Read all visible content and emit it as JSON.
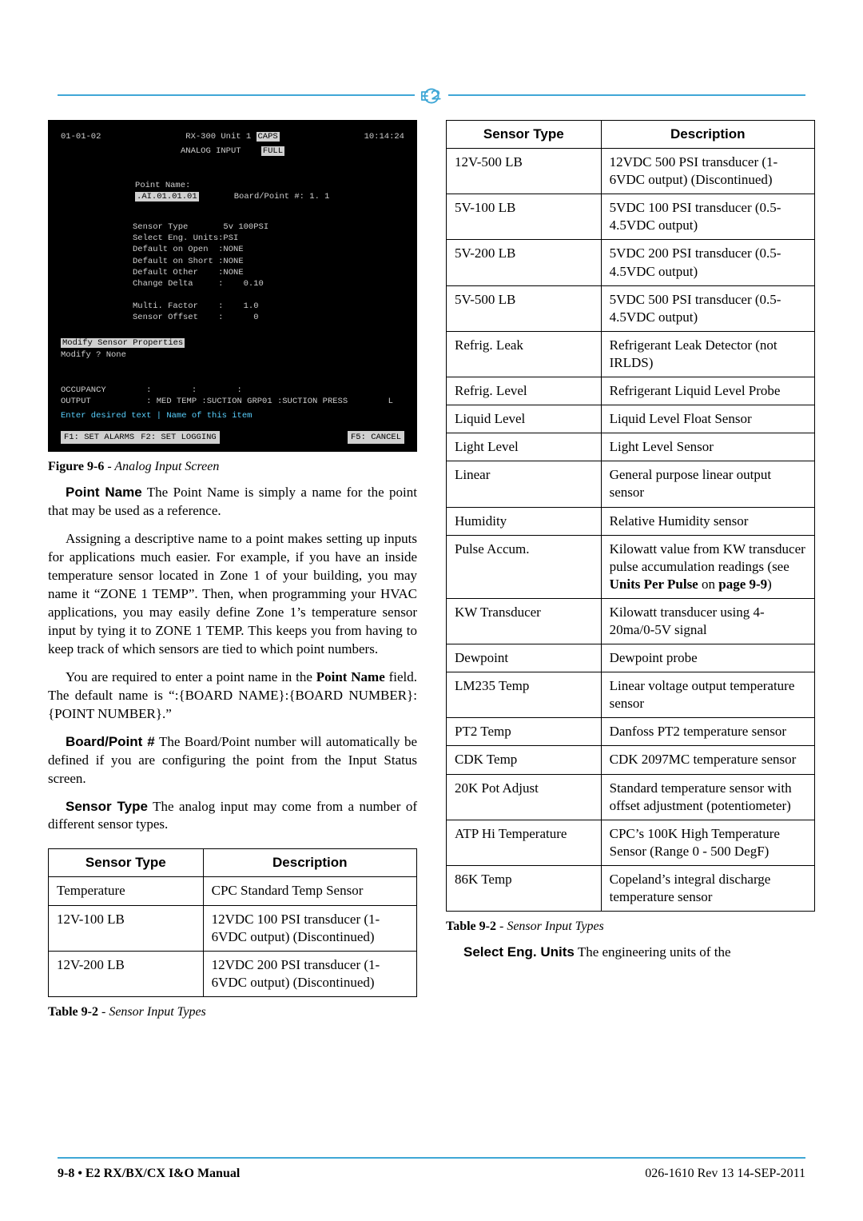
{
  "header": {
    "logo_label": "E2"
  },
  "left": {
    "terminal": {
      "date": "01-01-02",
      "title_line1": "RX-300 Unit 1",
      "caps": "CAPS",
      "title_line2": "ANALOG INPUT",
      "full": "FULL",
      "time": "10:14:24",
      "point_name_label": "Point Name:",
      "point_name_value": ".AI.01.01.01",
      "board_point_label": "Board/Point #:",
      "board_point_value": "1. 1",
      "rows": [
        {
          "k": "Sensor Type",
          "v": "5v 100PSI"
        },
        {
          "k": "Select Eng. Units:",
          "v": "PSI"
        },
        {
          "k": "Default on Open  :",
          "v": "NONE"
        },
        {
          "k": "Default on Short :",
          "v": "NONE"
        },
        {
          "k": "Default Other    :",
          "v": "NONE"
        },
        {
          "k": "Change Delta     :",
          "v": "    0.10"
        }
      ],
      "rows2": [
        {
          "k": "Multi. Factor    :",
          "v": "    1.0"
        },
        {
          "k": "Sensor Offset    :",
          "v": "      0"
        }
      ],
      "modify_line": "Modify Sensor Properties",
      "modify_sub": "Modify         ? None",
      "occ": "OCCUPANCY        :        :        :",
      "output": "OUTPUT           : MED TEMP :SUCTION GRP01 :SUCTION PRESS        L",
      "enter_hint": "Enter desired text  | Name of this item",
      "f1": "F1: SET ALARMS",
      "f2": "F2: SET LOGGING",
      "f5": "F5: CANCEL"
    },
    "fig_caption_bold": "Figure 9-6",
    "fig_caption_text": " - Analog Input Screen",
    "point_name_heading": "Point Name",
    "point_name_para": "   The Point Name is simply a name for the point that may be used as a reference.",
    "para2": "Assigning a descriptive name to a point makes setting up inputs for applications much easier. For example, if you have an inside temperature sensor located in Zone 1 of your building, you may name it “ZONE 1 TEMP”. Then, when programming your HVAC applications, you may easily define Zone 1’s temperature sensor input by tying it to ZONE 1 TEMP. This keeps you from having to keep track of which sensors are tied to which point numbers.",
    "para3_pre": "You are required to enter a point name in the ",
    "para3_bold": "Point Name",
    "para3_post": " field. The default name is “:{BOARD NAME}:{BOARD NUMBER}:{POINT NUMBER}.”",
    "bp_heading": "Board/Point #",
    "bp_para": "   The Board/Point number will automatically be defined if you are configuring the point from the Input Status screen.",
    "st_heading": "Sensor Type",
    "st_para": "   The analog input may come from a number of different sensor types.",
    "table1": {
      "headers": [
        "Sensor Type",
        "Description"
      ],
      "rows": [
        [
          "Temperature",
          "CPC Standard Temp Sensor"
        ],
        [
          "12V-100 LB",
          "12VDC 100 PSI transducer (1-6VDC output) (Discontinued)"
        ],
        [
          "12V-200 LB",
          "12VDC 200 PSI transducer (1-6VDC output) (Discontinued)"
        ]
      ],
      "caption_bold": "Table 9-2",
      "caption_text": " - Sensor Input Types"
    }
  },
  "right": {
    "table2": {
      "headers": [
        "Sensor Type",
        "Description"
      ],
      "rows": [
        [
          "12V-500 LB",
          "12VDC 500 PSI transducer (1-6VDC output) (Discontinued)"
        ],
        [
          "5V-100 LB",
          "5VDC 100 PSI transducer (0.5-4.5VDC output)"
        ],
        [
          "5V-200 LB",
          "5VDC 200 PSI transducer (0.5-4.5VDC output)"
        ],
        [
          "5V-500 LB",
          "5VDC 500 PSI transducer (0.5-4.5VDC output)"
        ],
        [
          "Refrig. Leak",
          "Refrigerant Leak Detector (not IRLDS)"
        ],
        [
          "Refrig. Level",
          "Refrigerant Liquid Level Probe"
        ],
        [
          "Liquid Level",
          "Liquid Level Float Sensor"
        ],
        [
          "Light Level",
          "Light Level Sensor"
        ],
        [
          "Linear",
          "General purpose linear output sensor"
        ],
        [
          "Humidity",
          "Relative Humidity sensor"
        ],
        [
          "Pulse Accum.",
          "Kilowatt value from KW transducer pulse accumulation readings (see <b>Units Per Pulse</b> on <b>page 9-9</b>)"
        ],
        [
          "KW Transducer",
          "Kilowatt transducer using 4-20ma/0-5V signal"
        ],
        [
          "Dewpoint",
          "Dewpoint probe"
        ],
        [
          "LM235 Temp",
          "Linear voltage output temperature sensor"
        ],
        [
          "PT2 Temp",
          "Danfoss PT2 temperature sensor"
        ],
        [
          "CDK Temp",
          "CDK 2097MC temperature sensor"
        ],
        [
          "20K Pot Adjust",
          "Standard temperature sensor with offset adjustment (potentiometer)"
        ],
        [
          "ATP Hi Temperature",
          "CPC’s 100K High Temperature Sensor (Range  0 - 500 DegF)"
        ],
        [
          "86K Temp",
          "Copeland’s integral discharge temperature sensor"
        ]
      ],
      "caption_bold": "Table 9-2",
      "caption_text": " - Sensor Input Types"
    },
    "seu_heading": "Select Eng. Units",
    "seu_para": "   The engineering units of the"
  },
  "footer": {
    "left_bold": "9-8 • E2 RX/BX/CX I&O Manual",
    "right": "026-1610 Rev 13 14-SEP-2011"
  }
}
